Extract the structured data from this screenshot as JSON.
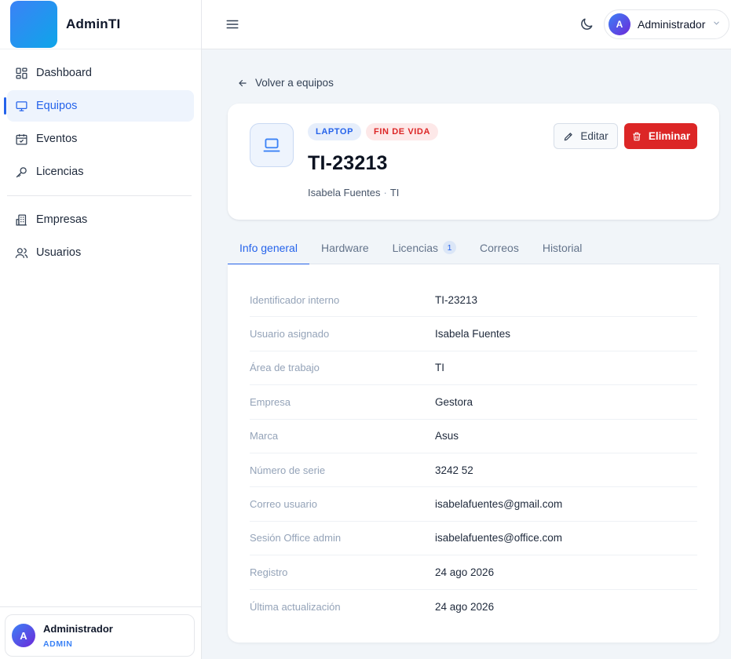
{
  "app": {
    "name": "AdminTI"
  },
  "sidebar": {
    "items": [
      {
        "label": "Dashboard",
        "icon": "dashboard-icon"
      },
      {
        "label": "Equipos",
        "icon": "monitor-icon",
        "active": true
      },
      {
        "label": "Eventos",
        "icon": "calendar-icon"
      },
      {
        "label": "Licencias",
        "icon": "key-icon"
      },
      {
        "label": "Empresas",
        "icon": "building-icon"
      },
      {
        "label": "Usuarios",
        "icon": "users-icon"
      }
    ],
    "user": {
      "initial": "A",
      "name": "Administrador",
      "role": "ADMIN"
    }
  },
  "topbar": {
    "user": {
      "initial": "A",
      "name": "Administrador"
    }
  },
  "back": {
    "label": "Volver a equipos"
  },
  "equipment": {
    "type_badge": "LAPTOP",
    "status_badge": "FIN DE VIDA",
    "code": "TI-23213",
    "owner": "Isabela Fuentes",
    "area": "TI",
    "separator": "·",
    "edit_label": "Editar",
    "delete_label": "Eliminar"
  },
  "tabs": [
    {
      "label": "Info general",
      "active": true
    },
    {
      "label": "Hardware"
    },
    {
      "label": "Licencias",
      "count": "1"
    },
    {
      "label": "Correos"
    },
    {
      "label": "Historial"
    }
  ],
  "details": [
    {
      "label": "Identificador interno",
      "value": "TI-23213"
    },
    {
      "label": "Usuario asignado",
      "value": "Isabela Fuentes"
    },
    {
      "label": "Área de trabajo",
      "value": "TI"
    },
    {
      "label": "Empresa",
      "value": "Gestora"
    },
    {
      "label": "Marca",
      "value": "Asus"
    },
    {
      "label": "Número de serie",
      "value": "3242 52"
    },
    {
      "label": "Correo usuario",
      "value": "isabelafuentes@gmail.com"
    },
    {
      "label": "Sesión Office admin",
      "value": "isabelafuentes@office.com"
    },
    {
      "label": "Registro",
      "value": "24 ago 2026"
    },
    {
      "label": "Última actualización",
      "value": "24 ago 2026"
    }
  ],
  "colors": {
    "accent": "#2563eb",
    "danger": "#dc2626",
    "background": "#f1f5f9"
  }
}
